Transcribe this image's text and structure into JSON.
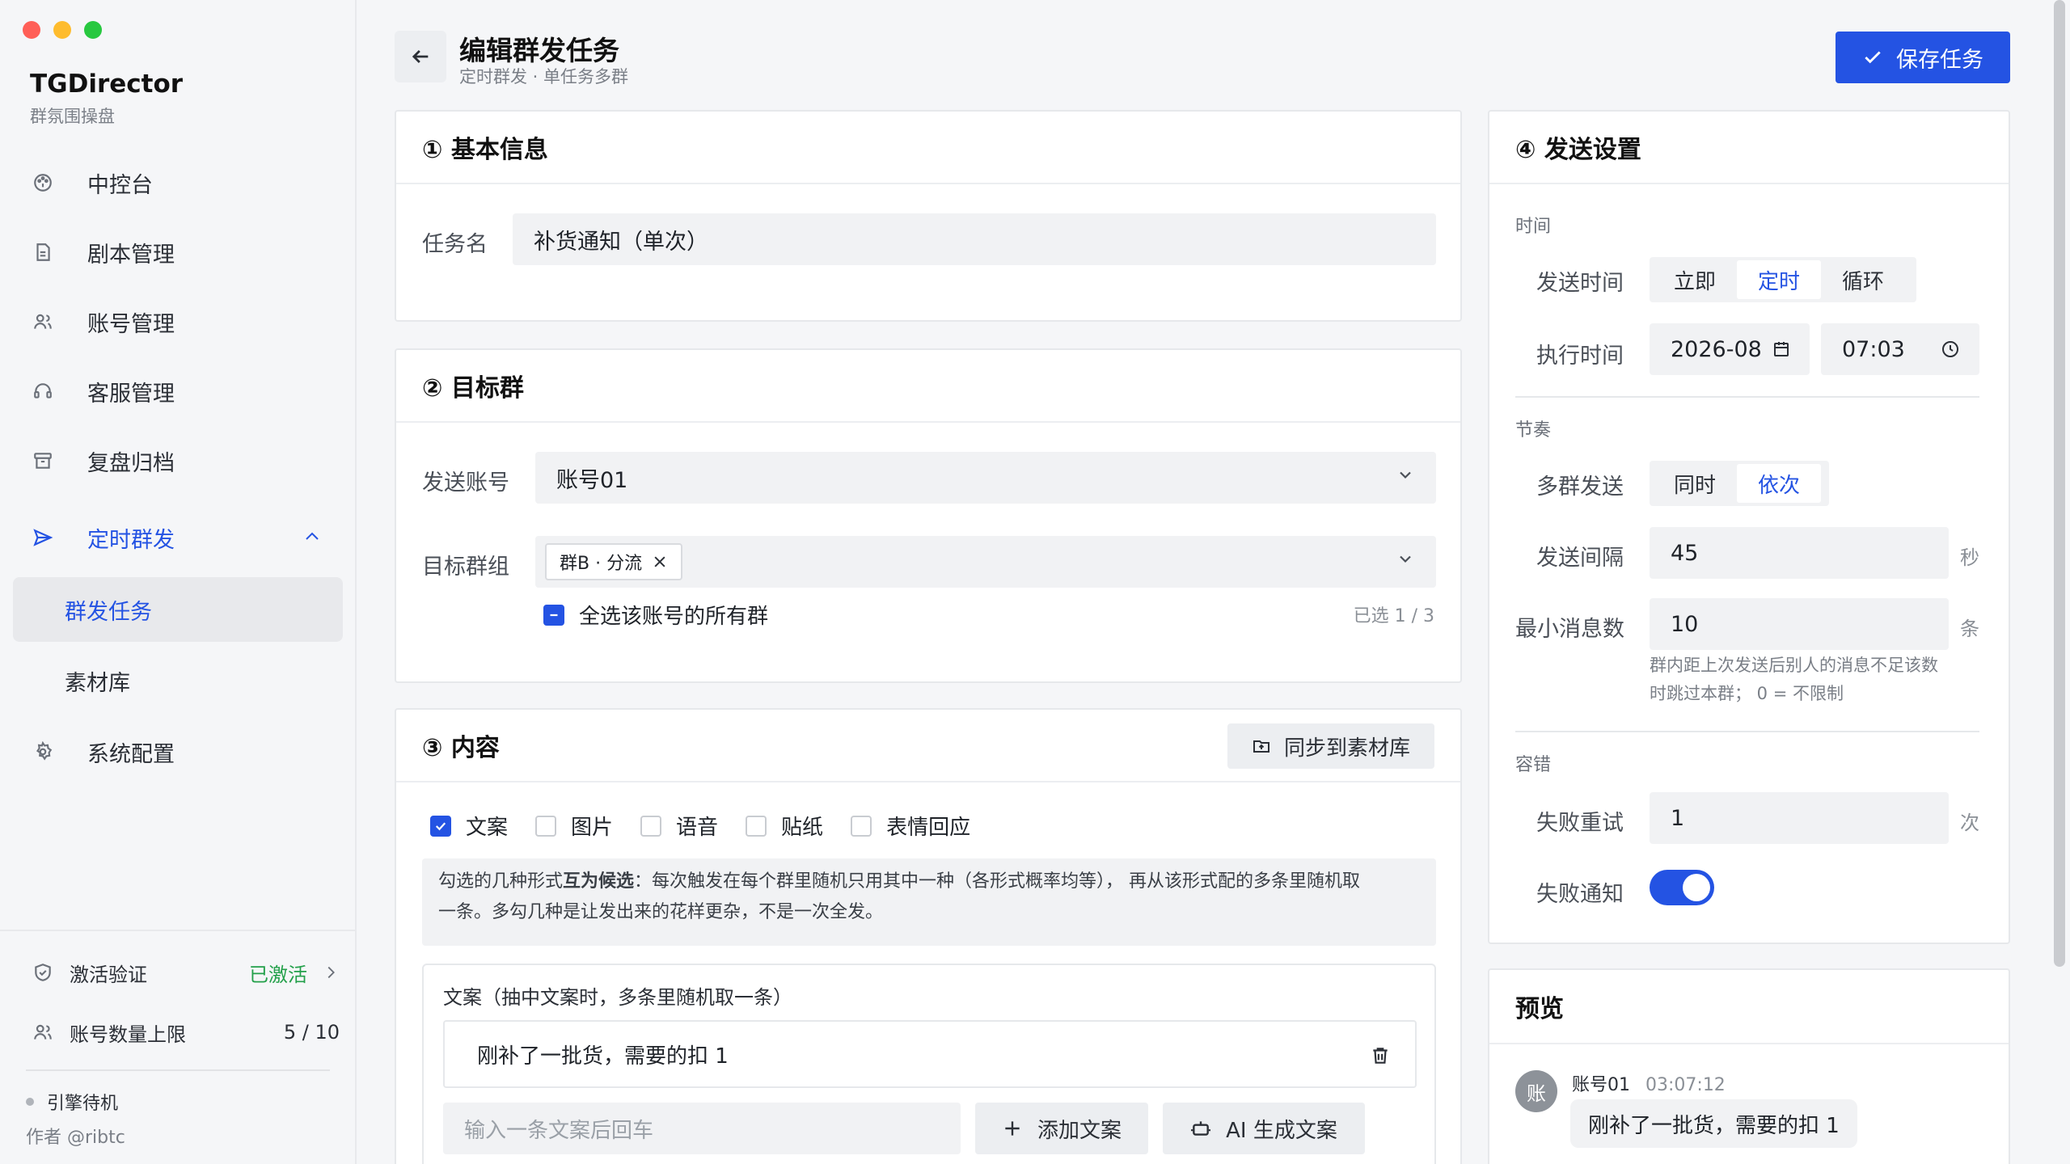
{
  "app": {
    "title": "TGDirector",
    "subtitle": "群氛围操盘"
  },
  "nav": {
    "items": [
      {
        "label": "中控台",
        "icon": "dashboard-icon"
      },
      {
        "label": "剧本管理",
        "icon": "document-icon"
      },
      {
        "label": "账号管理",
        "icon": "users-icon"
      },
      {
        "label": "客服管理",
        "icon": "headset-icon"
      },
      {
        "label": "复盘归档",
        "icon": "archive-icon"
      },
      {
        "label": "定时群发",
        "icon": "send-icon"
      }
    ],
    "sub_items": [
      {
        "label": "群发任务"
      },
      {
        "label": "素材库"
      }
    ],
    "settings": {
      "label": "系统配置",
      "icon": "gear-icon"
    }
  },
  "footer": {
    "activation_label": "激活验证",
    "activation_status": "已激活",
    "account_limit_label": "账号数量上限",
    "account_limit_value": "5 / 10",
    "engine_status": "引擎待机",
    "author": "作者 @ribtc"
  },
  "header": {
    "title": "编辑群发任务",
    "subtitle": "定时群发 · 单任务多群",
    "save_label": "保存任务"
  },
  "basic": {
    "title": "① 基本信息",
    "task_name_label": "任务名",
    "task_name_value": "补货通知（单次）"
  },
  "target": {
    "title": "② 目标群",
    "account_label": "发送账号",
    "account_value": "账号01",
    "group_label": "目标群组",
    "group_tag": "群B · 分流",
    "select_all_label": "全选该账号的所有群",
    "selected_count": "已选 1 / 3"
  },
  "content": {
    "title": "③ 内容",
    "sync_label": "同步到素材库",
    "types": [
      {
        "label": "文案",
        "checked": true
      },
      {
        "label": "图片",
        "checked": false
      },
      {
        "label": "语音",
        "checked": false
      },
      {
        "label": "贴纸",
        "checked": false
      },
      {
        "label": "表情回应",
        "checked": false
      }
    ],
    "hint_prefix": "勾选的几种形式",
    "hint_bold": "互为候选",
    "hint_rest": "：每次触发在每个群里随机只用其中一种（各形式概率均等）， 再从该形式配的多条里随机取",
    "hint_line2": "一条。多勾几种是让发出来的花样更杂，不是一次全发。",
    "copy_box_title": "文案（抽中文案时，多条里随机取一条）",
    "copy_item": "刚补了一批货，需要的扣 1",
    "copy_placeholder": "输入一条文案后回车",
    "add_copy_label": "添加文案",
    "ai_copy_label": "AI 生成文案"
  },
  "send": {
    "title": "④ 发送设置",
    "time_caption": "时间",
    "send_time_label": "发送时间",
    "send_time_options": [
      "立即",
      "定时",
      "循环"
    ],
    "send_time_selected": "定时",
    "exec_time_label": "执行时间",
    "exec_date": "2026-08",
    "exec_clock": "07:03",
    "rhythm_caption": "节奏",
    "multi_label": "多群发送",
    "multi_options": [
      "同时",
      "依次"
    ],
    "multi_selected": "依次",
    "interval_label": "发送间隔",
    "interval_value": "45",
    "interval_unit": "秒",
    "min_msg_label": "最小消息数",
    "min_msg_value": "10",
    "min_msg_unit": "条",
    "min_msg_note_1": "群内距上次发送后别人的消息不足该数",
    "min_msg_note_2": "时跳过本群； 0 = 不限制",
    "fault_caption": "容错",
    "retry_label": "失败重试",
    "retry_value": "1",
    "retry_unit": "次",
    "notify_label": "失败通知",
    "notify_on": true
  },
  "preview": {
    "title": "预览",
    "avatar_text": "账",
    "sender": "账号01",
    "time": "03:07:12",
    "message": "刚补了一批货，需要的扣 1"
  },
  "colors": {
    "accent": "#2453e3",
    "success": "#23a04a"
  }
}
